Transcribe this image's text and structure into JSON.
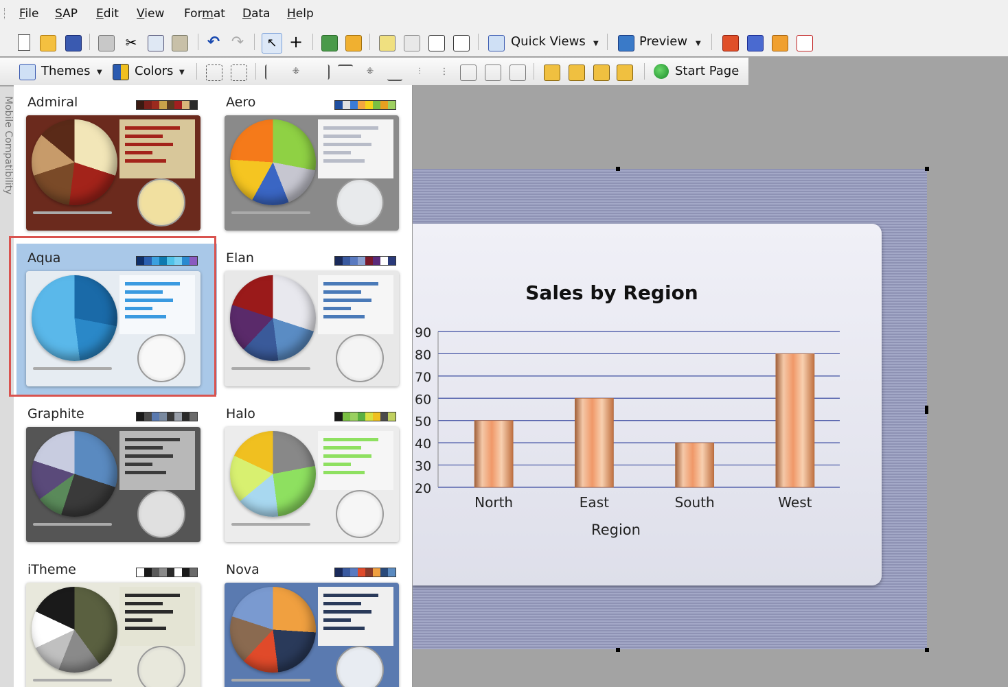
{
  "menubar": {
    "items": [
      {
        "id": "file",
        "label": "File",
        "ul": "F"
      },
      {
        "id": "sap",
        "label": "SAP",
        "ul": "S"
      },
      {
        "id": "edit",
        "label": "Edit",
        "ul": "E"
      },
      {
        "id": "view",
        "label": "View",
        "ul": "V"
      },
      {
        "id": "format",
        "label": "Format",
        "ul": "m"
      },
      {
        "id": "data",
        "label": "Data",
        "ul": "D"
      },
      {
        "id": "help",
        "label": "Help",
        "ul": "H"
      }
    ]
  },
  "toolbar": {
    "quick_views_label": "Quick Views",
    "preview_label": "Preview",
    "themes_label": "Themes",
    "colors_label": "Colors",
    "start_page_label": "Start Page"
  },
  "left_strip": {
    "label": "Mobile Compatibility"
  },
  "themes": [
    {
      "name": "Admiral",
      "selected": false,
      "swatches": [
        "#3a1a12",
        "#7a1f1a",
        "#9b2a1e",
        "#c8a24a",
        "#5a3a20",
        "#a31f20",
        "#d9b77a",
        "#2a2a2a"
      ],
      "bg": "#6b2a1d",
      "pie": "conic-gradient(#f2e6b8 0 30%,#a3231a 30% 52%,#7a4a28 52% 70%,#c79b6a 70% 86%,#5a2a18 86% 100%)",
      "bar": "#a3231a",
      "barbg": "#d8c79a",
      "gauge": "#f1e0a0"
    },
    {
      "name": "Aero",
      "selected": false,
      "swatches": [
        "#1f4fa0",
        "#e0e0e0",
        "#3b7bd6",
        "#f2a640",
        "#f5d31a",
        "#7ac043",
        "#e8a020",
        "#9ed060"
      ],
      "bg": "#8a8a8a",
      "pie": "conic-gradient(#8fd144 0 28%,#c6c6d0 28% 44%,#3a66c4 44% 58%,#f5c521 58% 76%,#f57a1a 76% 100%)",
      "bar": "#b8bcc8",
      "barbg": "#f4f4f4",
      "gauge": "#e8eaec"
    },
    {
      "name": "Aqua",
      "selected": true,
      "swatches": [
        "#0e2f6a",
        "#2a5fb0",
        "#3aa0e0",
        "#0d7ab0",
        "#4fc2e8",
        "#7ad0f2",
        "#2a8ad0",
        "#8a5ac0"
      ],
      "bg": "#e6ecf2",
      "pie": "conic-gradient(#1a6aa8 0 28%,#2a88c8 28% 48%,#5ab8ea 48% 100%)",
      "bar": "#3a9ae0",
      "barbg": "#f6f9fc",
      "gauge": "#f8f8f8"
    },
    {
      "name": "Elan",
      "selected": false,
      "swatches": [
        "#1a2a5a",
        "#3a5aa0",
        "#5a7ac0",
        "#8aa0d0",
        "#7a1a2a",
        "#5a2a7a",
        "#ffffff",
        "#2a3a7a"
      ],
      "bg": "#e8e8e8",
      "pie": "conic-gradient(#e8e8ee 0 30%,#5a8cc4 30% 48%,#3a5a9a 48% 62%,#5a2a6a 62% 80%,#9a1a1a 80% 100%)",
      "bar": "#4a7ab8",
      "barbg": "#f6f6f6",
      "gauge": "#f4f4f4"
    },
    {
      "name": "Graphite",
      "selected": false,
      "swatches": [
        "#1a1a1a",
        "#4a4a4a",
        "#5a7ab0",
        "#7a8aa0",
        "#3a3a3a",
        "#9aa0aa",
        "#2a2a2a",
        "#6a6a6a"
      ],
      "bg": "#555555",
      "pie": "conic-gradient(#5a8ac0 0 30%,#3a3a3a 30% 55%,#5a8a5a 55% 65%,#5a4a7a 65% 80%,#c8cce0 80% 100%)",
      "bar": "#3a3a3a",
      "barbg": "#b8b8b8",
      "gauge": "#e0e0e0"
    },
    {
      "name": "Halo",
      "selected": false,
      "swatches": [
        "#1a1a1a",
        "#7ac043",
        "#9ad060",
        "#5ab040",
        "#d8e040",
        "#f0c020",
        "#4a4a4a",
        "#c0d060"
      ],
      "bg": "#ececec",
      "pie": "conic-gradient(#888888 0 22%,#8ee060 22% 48%,#a8d8f0 48% 64%,#d8f070 64% 82%,#f0c020 82% 100%)",
      "bar": "#8ee060",
      "barbg": "#f6f6f6",
      "gauge": "#f6f6f6"
    },
    {
      "name": "iTheme",
      "selected": false,
      "swatches": [
        "#ffffff",
        "#1a1a1a",
        "#5a5a5a",
        "#8a8a8a",
        "#2a2a2a",
        "#ffffff",
        "#1a1a1a",
        "#6a6a6a"
      ],
      "bg": "#e8e8dc",
      "pie": "conic-gradient(#5a6040 0 40%,#8a8a8a 40% 56%,#c0c0c0 56% 68%,#ffffff 68% 82%,#1a1a1a 82% 100%)",
      "bar": "#2a2a2a",
      "barbg": "#e4e4d4",
      "gauge": "#e8e8dc"
    },
    {
      "name": "Nova",
      "selected": false,
      "swatches": [
        "#1a2a5a",
        "#3a5aa0",
        "#5a7ac0",
        "#e04a2a",
        "#8a3a2a",
        "#f0a040",
        "#2a4a7a",
        "#5a8ac0"
      ],
      "bg": "#5a7ab0",
      "pie": "conic-gradient(#f0a040 0 26%,#2a3a5a 26% 48%,#e04a2a 48% 62%,#8a6a50 62% 80%,#7a9ad0 80% 100%)",
      "bar": "#2a3a5a",
      "barbg": "#f0f0f0",
      "gauge": "#e8ecf2"
    }
  ],
  "chart_data": {
    "type": "bar",
    "title": "Sales by Region",
    "xlabel": "Region",
    "ylabel": "",
    "categories": [
      "North",
      "East",
      "South",
      "West"
    ],
    "values": [
      50,
      60,
      40,
      80
    ],
    "ylim": [
      20,
      90
    ],
    "yticks": [
      20,
      30,
      40,
      50,
      60,
      70,
      80,
      90
    ],
    "grid": true,
    "bar_color": "#f0a070",
    "grid_color": "#3a4aa0"
  }
}
